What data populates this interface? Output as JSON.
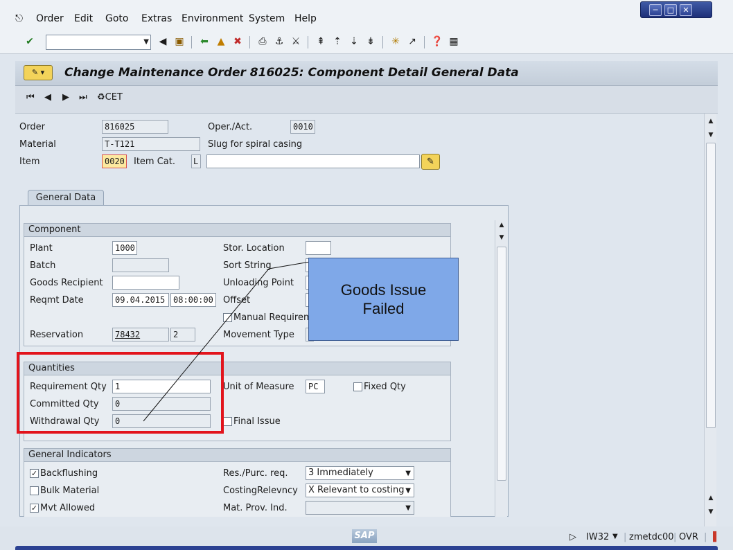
{
  "menu": [
    "Order",
    "Edit",
    "Goto",
    "Extras",
    "Environment",
    "System",
    "Help"
  ],
  "window_controls": [
    "minimize",
    "maximize",
    "close"
  ],
  "command_field": {
    "value": ""
  },
  "title": "Change Maintenance Order 816025: Component Detail General Data",
  "app_toolbar": {
    "cet_label": "CET"
  },
  "header": {
    "order_label": "Order",
    "order_value": "816025",
    "operact_label": "Oper./Act.",
    "operact_value": "0010",
    "material_label": "Material",
    "material_value": "T-T121",
    "material_desc": "Slug for spiral casing",
    "item_label": "Item",
    "item_value": "0020",
    "itemcat_label": "Item Cat.",
    "itemcat_value": "L",
    "item_text_value": ""
  },
  "tab": {
    "label": "General Data"
  },
  "component": {
    "title": "Component",
    "plant_label": "Plant",
    "plant_value": "1000",
    "batch_label": "Batch",
    "batch_value": "",
    "goods_recipient_label": "Goods Recipient",
    "goods_recipient_value": "",
    "reqmt_date_label": "Reqmt Date",
    "reqmt_date_value": "09.04.2015",
    "reqmt_time_value": "08:00:00",
    "reservation_label": "Reservation",
    "reservation_value": "78432",
    "reservation_item": "2",
    "stor_location_label": "Stor. Location",
    "stor_location_value": "",
    "sort_string_label": "Sort String",
    "unloading_point_label": "Unloading Point",
    "offset_label": "Offset",
    "manual_req_label": "Manual Requireme",
    "movement_type_label": "Movement Type"
  },
  "quantities": {
    "title": "Quantities",
    "requirement_qty_label": "Requirement Qty",
    "requirement_qty_value": "1",
    "committed_qty_label": "Committed Qty",
    "committed_qty_value": "0",
    "withdrawal_qty_label": "Withdrawal Qty",
    "withdrawal_qty_value": "0",
    "unit_label": "Unit of Measure",
    "unit_value": "PC",
    "fixed_qty_label": "Fixed Qty",
    "final_issue_label": "Final Issue"
  },
  "general_indicators": {
    "title": "General Indicators",
    "backflushing_label": "Backflushing",
    "backflushing_checked": true,
    "bulk_material_label": "Bulk Material",
    "bulk_material_checked": false,
    "mvt_allowed_label": "Mvt Allowed",
    "mvt_allowed_checked": true,
    "res_purc_label": "Res./Purc. req.",
    "res_purc_value": "3 Immediately",
    "costing_label": "CostingRelevncy",
    "costing_value": "X Relevant to costing",
    "mat_prov_label": "Mat. Prov. Ind.",
    "mat_prov_value": ""
  },
  "callout": {
    "line1": "Goods Issue",
    "line2": "Failed"
  },
  "status": {
    "transaction": "IW32",
    "user": "zmetdc00",
    "mode": "OVR"
  },
  "colors": {
    "callout_fill": "#7fa8e8",
    "highlight_red": "#e2141c",
    "title_bg": "#c9d3de"
  }
}
